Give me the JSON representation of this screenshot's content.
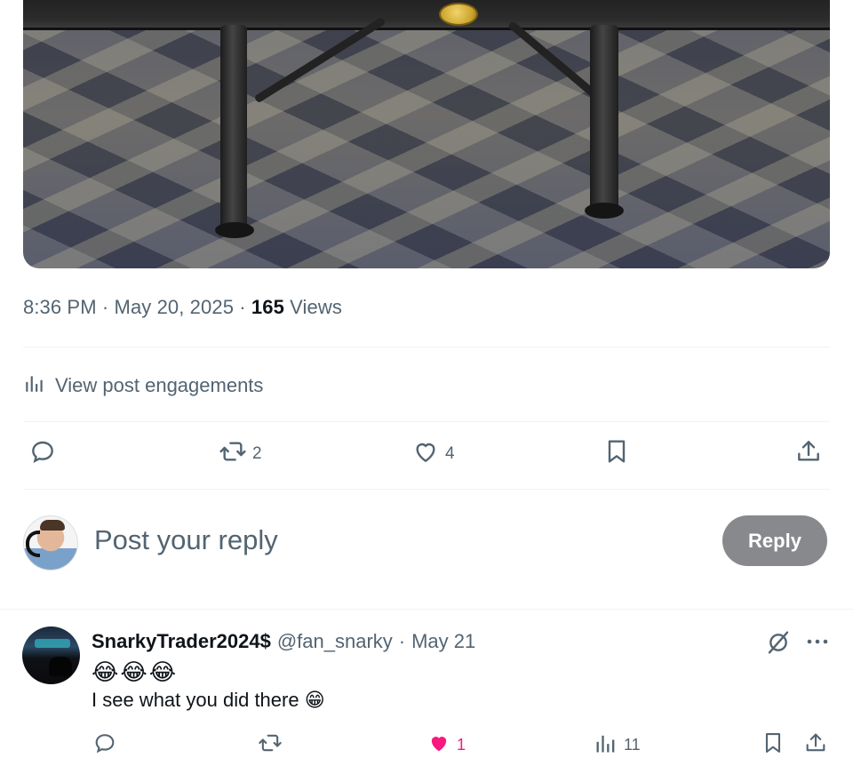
{
  "post": {
    "time": "8:36 PM",
    "separator": "·",
    "date": "May 20, 2025",
    "views_count": "165",
    "views_label": "Views",
    "engagements_label": "View post engagements",
    "actions": {
      "reposts": "2",
      "likes": "4"
    }
  },
  "reply_box": {
    "placeholder": "Post your reply",
    "button_label": "Reply"
  },
  "reply": {
    "display_name": "SnarkyTrader2024$",
    "handle": "@fan_snarky",
    "separator": "·",
    "date": "May 21",
    "emoji_line": "😂😂😂",
    "text": "I see what you did there 😁",
    "actions": {
      "likes": "1",
      "views": "11"
    },
    "liked_color": "#f91880"
  },
  "icons": [
    "image-photo",
    "analytics-icon",
    "reply-icon",
    "repost-icon",
    "like-icon",
    "bookmark-icon",
    "share-icon",
    "grok-icon",
    "more-icon"
  ]
}
